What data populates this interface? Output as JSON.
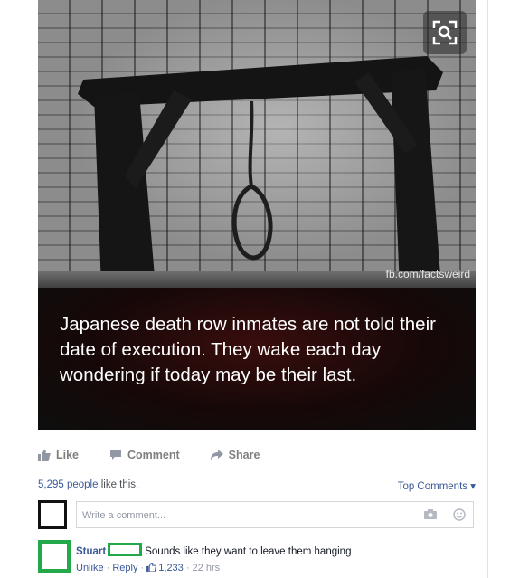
{
  "post": {
    "watermark": "fb.com/factsweird",
    "caption": "Japanese death row inmates are not told their date of execution. They wake each day wondering if today may be their last."
  },
  "actions": {
    "like_label": "Like",
    "comment_label": "Comment",
    "share_label": "Share"
  },
  "likes": {
    "count_text": "5,295 people",
    "suffix_text": " like this.",
    "top_comments_label": "Top Comments ▾"
  },
  "comment_box": {
    "placeholder": "Write a comment..."
  },
  "reply": {
    "author": "Stuart",
    "text": "Sounds like they want to leave them hanging",
    "unlike_label": "Unlike",
    "separator": " · ",
    "reply_label": "Reply",
    "like_count": "1,233",
    "time": "22 hrs"
  },
  "colors": {
    "accent": "#3b5998",
    "redaction_green": "#23a94a",
    "redaction_black": "#111111"
  }
}
